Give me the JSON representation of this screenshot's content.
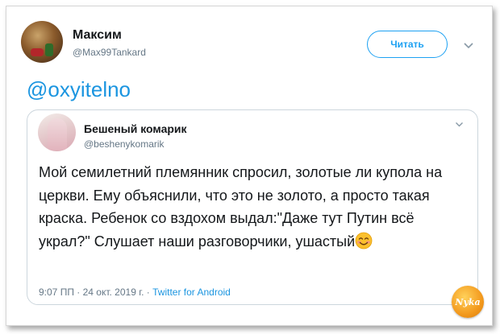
{
  "tweet": {
    "author_name": "Максим",
    "author_handle": "@Max99Tankard",
    "follow_label": "Читать",
    "reply_mention": "@oxyitelno"
  },
  "quoted": {
    "author_name": "Бешеный комарик",
    "author_handle": "@beshenykomarik",
    "text": "Мой семилетний племянник спросил, золотые ли купола на церкви. Ему объяснили, что это не золото, а просто такая краска. Ребенок со вздохом выдал:\"Даже тут Путин всё украл?\" Слушает наши разговорчики, ушастый",
    "emoji": "smiling-face-emoji",
    "time": "9:07 ПП · 24 окт. 2019 г. · ",
    "source": "Twitter for Android"
  },
  "watermark": {
    "text": "Nyka"
  },
  "colors": {
    "accent": "#1da1f2",
    "link": "#1b95e0",
    "muted": "#657786",
    "text": "#14171a",
    "border": "#ccd6dd"
  }
}
